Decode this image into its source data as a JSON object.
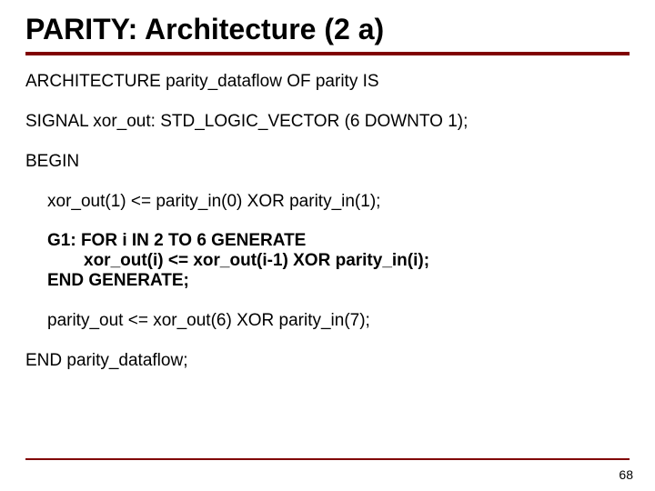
{
  "title": "PARITY: Architecture (2 a)",
  "code": {
    "l1": "ARCHITECTURE parity_dataflow OF parity IS",
    "l2": "SIGNAL xor_out: STD_LOGIC_VECTOR (6 DOWNTO 1);",
    "l3": "BEGIN",
    "l4": "xor_out(1) <= parity_in(0) XOR parity_in(1);",
    "l5": "G1: FOR i IN 2 TO 6 GENERATE",
    "l6": "xor_out(i) <= xor_out(i-1) XOR parity_in(i);",
    "l7": "END GENERATE;",
    "l8": "parity_out <= xor_out(6) XOR parity_in(7);",
    "l9": "END parity_dataflow;"
  },
  "page_number": "68"
}
